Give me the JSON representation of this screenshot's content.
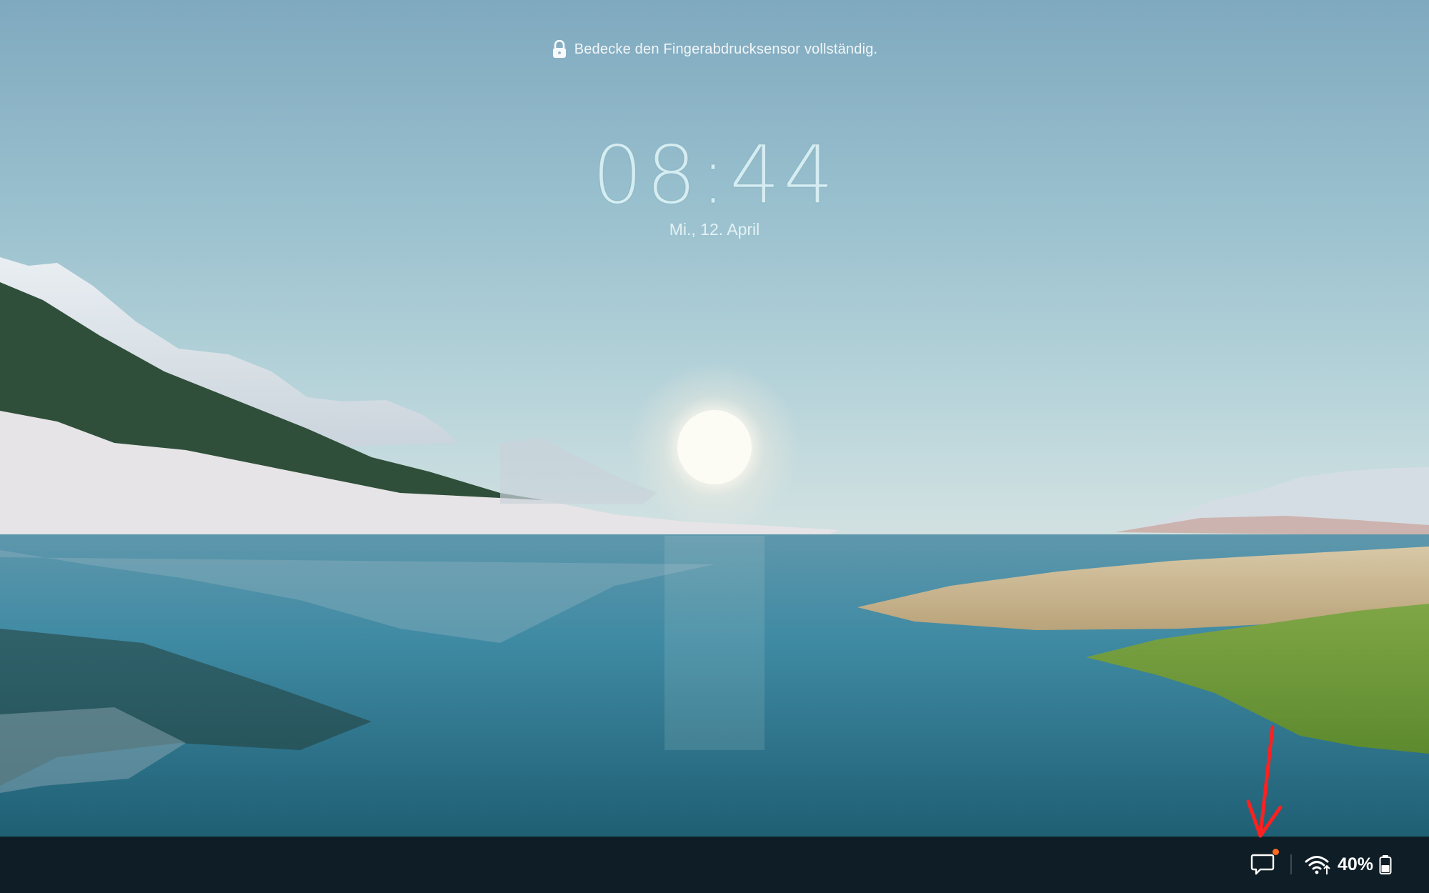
{
  "lockscreen": {
    "hint_text": "Bedecke den Fingerabdrucksensor vollständig.",
    "lock_icon": "lock-icon",
    "time": "08:44",
    "date": "Mi., 12. April"
  },
  "taskbar": {
    "notification_icon": "chat-bubble-icon",
    "notification_dot_color": "#ff6a1f",
    "wifi_icon": "wifi-icon",
    "battery_percent": "40%",
    "battery_icon": "battery-icon"
  },
  "annotation": {
    "arrow_color": "#ff2020"
  }
}
